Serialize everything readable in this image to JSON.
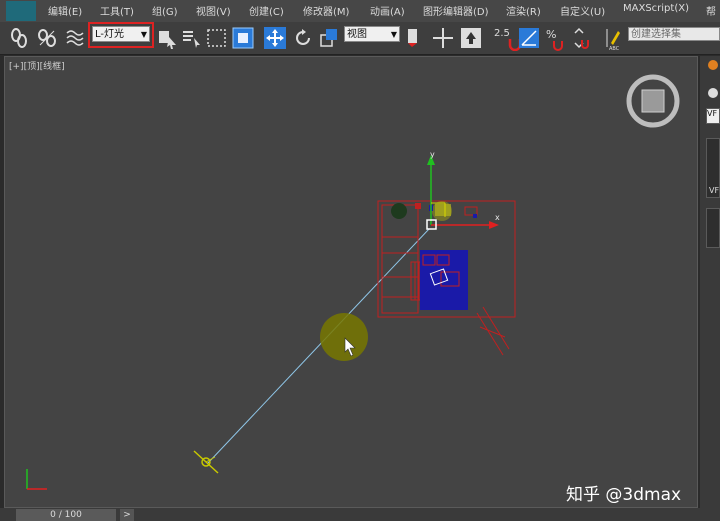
{
  "menubar": {
    "items": [
      "编辑(E)",
      "工具(T)",
      "组(G)",
      "视图(V)",
      "创建(C)",
      "修改器(M)",
      "动画(A)",
      "图形编辑器(D)",
      "渲染(R)",
      "自定义(U)",
      "MAXScript(X)",
      "帮"
    ]
  },
  "toolbar": {
    "selection_filter": "L-灯光",
    "reference_coord": "视图",
    "snap_value": "2.5",
    "named_selection_placeholder": "创建选择集"
  },
  "viewport": {
    "label": "[+][顶][线框]",
    "axis_x": "x",
    "axis_y": "y"
  },
  "right_panel": {
    "label1": "VF",
    "label2": "VF"
  },
  "timeline": {
    "frame": "0 / 100",
    "next": ">"
  },
  "watermark": "知乎 @3dmax",
  "colors": {
    "viewport_bg": "#444444",
    "gizmo_x": "#e02020",
    "gizmo_y": "#20c020",
    "selection_red": "#d22222",
    "object_blue": "#1a1aa8",
    "light_yellow": "#c8c800"
  }
}
